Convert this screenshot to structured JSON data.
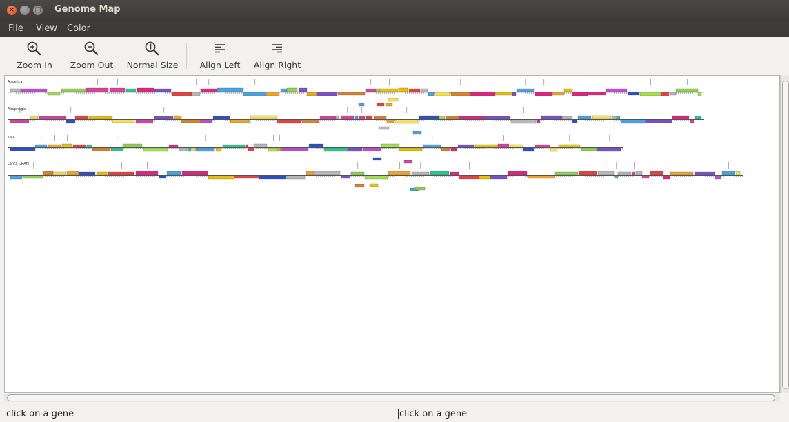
{
  "window": {
    "title": "Genome Map",
    "controls": [
      "close-icon",
      "minimize-icon",
      "maximize-icon"
    ]
  },
  "menubar": {
    "items": [
      {
        "label": "File"
      },
      {
        "label": "View"
      },
      {
        "label": "Color"
      }
    ]
  },
  "toolbar": {
    "zoom_in": {
      "label": "Zoom In",
      "icon": "zoom-in-icon"
    },
    "zoom_out": {
      "label": "Zoom Out",
      "icon": "zoom-out-icon"
    },
    "normal_size": {
      "label": "Normal Size",
      "icon": "zoom-normal-icon"
    },
    "align_left": {
      "label": "Align Left",
      "icon": "align-left-icon"
    },
    "align_right": {
      "label": "Align Right",
      "icon": "align-right-icon"
    }
  },
  "genomes": [
    {
      "name": "Angelica"
    },
    {
      "name": "Alrephagia"
    },
    {
      "name": "TM4"
    },
    {
      "name": "Lancs DRAFT"
    }
  ],
  "palette": [
    "#e6c300",
    "#2b4fc8",
    "#e0257c",
    "#8fd14f",
    "#d7429c",
    "#c24bd6",
    "#2ec48e",
    "#f0a42a",
    "#e64141",
    "#4aa3df",
    "#a6e04a",
    "#7a4fc8",
    "#f5e05a",
    "#d9822b",
    "#b8b8b8"
  ],
  "status": {
    "left_text": "click on a gene",
    "right_text": "click on a gene"
  }
}
